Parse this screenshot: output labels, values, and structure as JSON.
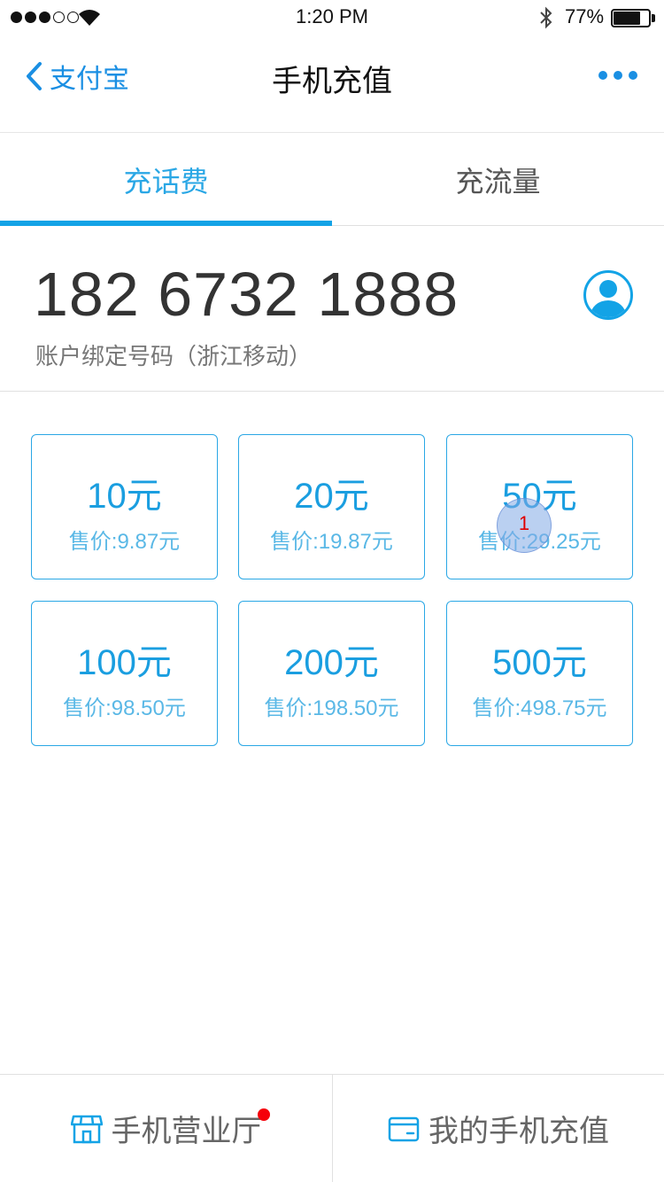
{
  "status_bar": {
    "time": "1:20 PM",
    "battery_percent": "77%",
    "battery_level": 0.77,
    "signal_filled": 3,
    "signal_total": 5
  },
  "nav": {
    "back_label": "支付宝",
    "title": "手机充值"
  },
  "tabs": [
    {
      "label": "充话费",
      "active": true
    },
    {
      "label": "充流量",
      "active": false
    }
  ],
  "phone": {
    "number": "182 6732 1888",
    "description": "账户绑定号码（浙江移动）"
  },
  "amounts": [
    {
      "amount": "10元",
      "price": "售价:9.87元"
    },
    {
      "amount": "20元",
      "price": "售价:19.87元"
    },
    {
      "amount": "50元",
      "price": "售价:29.25元"
    },
    {
      "amount": "100元",
      "price": "售价:98.50元"
    },
    {
      "amount": "200元",
      "price": "售价:198.50元"
    },
    {
      "amount": "500元",
      "price": "售价:498.75元"
    }
  ],
  "touch_marker": {
    "label": "1"
  },
  "bottom": {
    "store_label": "手机营业厅",
    "my_recharge_label": "我的手机充值"
  },
  "colors": {
    "accent": "#1a8fe3",
    "tab_active": "#2aa7e5",
    "indicator": "#13a3e6",
    "notification": "#f5000a"
  }
}
